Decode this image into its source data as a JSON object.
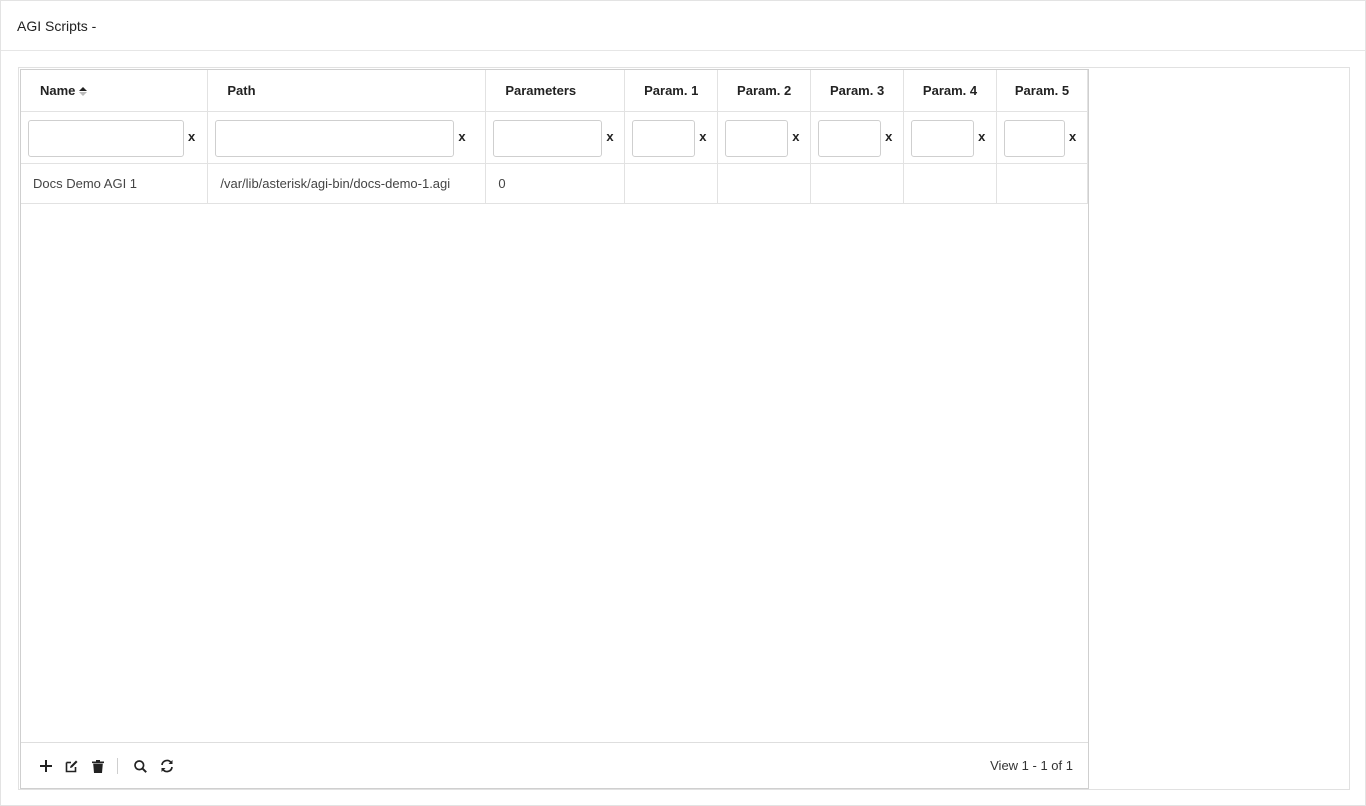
{
  "page": {
    "title": "AGI Scripts -"
  },
  "grid": {
    "columns": [
      {
        "key": "name",
        "label": "Name",
        "sorted": "asc"
      },
      {
        "key": "path",
        "label": "Path"
      },
      {
        "key": "parameters",
        "label": "Parameters"
      },
      {
        "key": "param1",
        "label": "Param. 1"
      },
      {
        "key": "param2",
        "label": "Param. 2"
      },
      {
        "key": "param3",
        "label": "Param. 3"
      },
      {
        "key": "param4",
        "label": "Param. 4"
      },
      {
        "key": "param5",
        "label": "Param. 5"
      }
    ],
    "filter_clear_label": "x",
    "filters": [
      "",
      "",
      "",
      "",
      "",
      "",
      "",
      ""
    ],
    "rows": [
      {
        "name": "Docs Demo AGI 1",
        "path": "/var/lib/asterisk/agi-bin/docs-demo-1.agi",
        "parameters": "0",
        "param1": "",
        "param2": "",
        "param3": "",
        "param4": "",
        "param5": ""
      }
    ]
  },
  "toolbar": {
    "buttons": [
      {
        "name": "add-icon",
        "action": "add"
      },
      {
        "name": "edit-icon",
        "action": "edit"
      },
      {
        "name": "delete-icon",
        "action": "delete"
      },
      {
        "name": "search-icon",
        "action": "search"
      },
      {
        "name": "refresh-icon",
        "action": "refresh"
      }
    ]
  },
  "pager": {
    "info": "View 1 - 1 of 1"
  }
}
